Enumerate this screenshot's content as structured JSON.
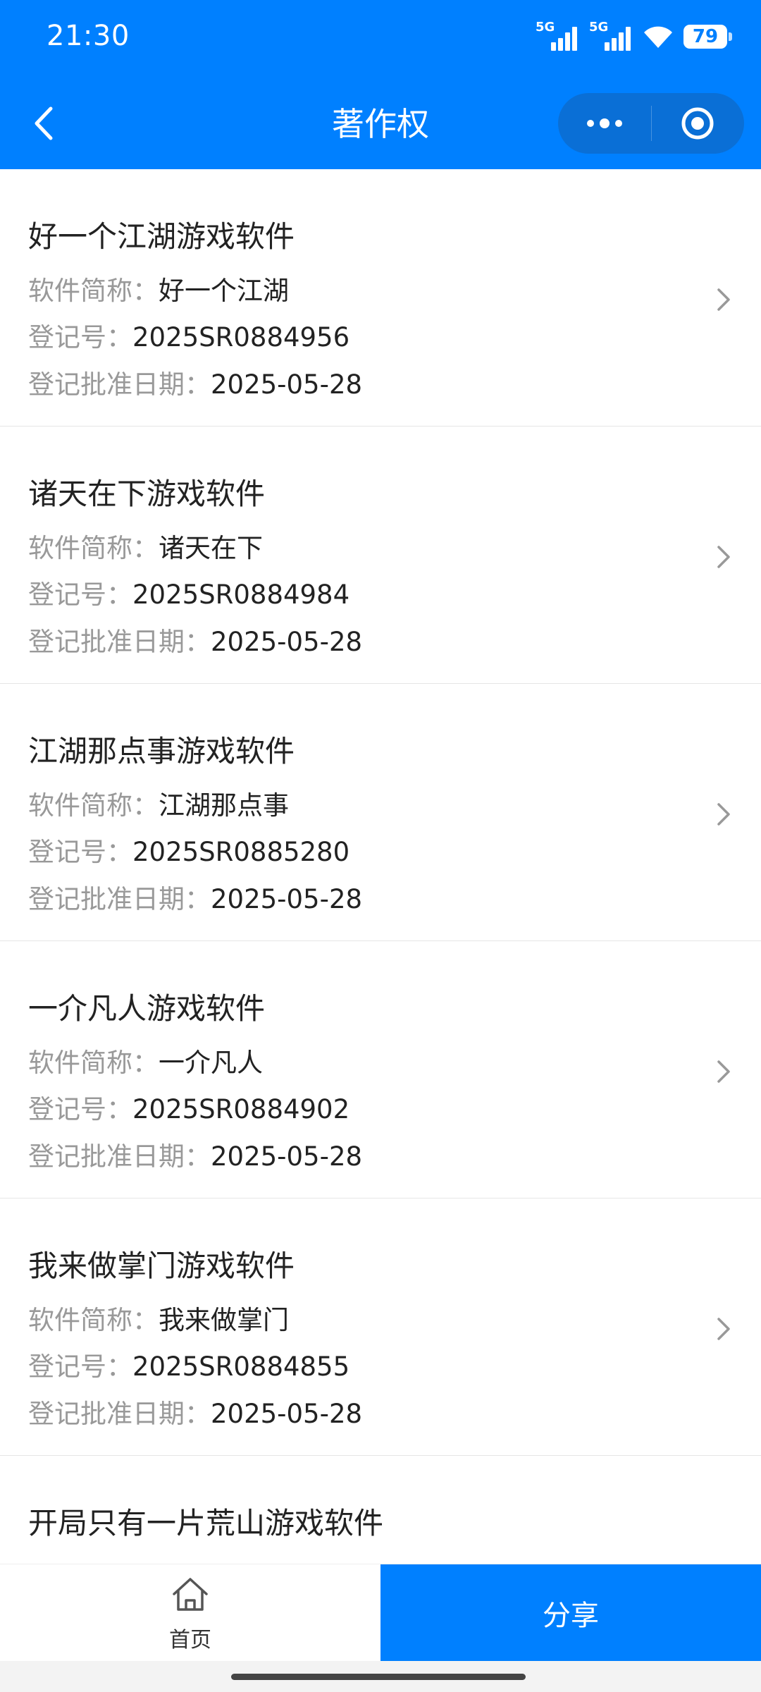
{
  "status_bar": {
    "time": "21:30",
    "signal1_label": "5G",
    "signal2_label": "5G",
    "battery": "79",
    "icons": [
      "signal-5g-icon",
      "signal-5g-icon",
      "wifi-icon",
      "battery-icon"
    ]
  },
  "nav": {
    "title": "著作权",
    "back_icon": "chevron-left-icon",
    "more_icon": "more-dots-icon",
    "close_icon": "target-circle-icon"
  },
  "items": [
    {
      "title": "好一个江湖游戏软件",
      "short_label": "软件简称：",
      "short_value": "好一个江湖",
      "reg_label": "登记号：",
      "reg_value": "2025SR0884956",
      "date_label": "登记批准日期：",
      "date_value": "2025-05-28"
    },
    {
      "title": "诸天在下游戏软件",
      "short_label": "软件简称：",
      "short_value": "诸天在下",
      "reg_label": "登记号：",
      "reg_value": "2025SR0884984",
      "date_label": "登记批准日期：",
      "date_value": "2025-05-28"
    },
    {
      "title": "江湖那点事游戏软件",
      "short_label": "软件简称：",
      "short_value": "江湖那点事",
      "reg_label": "登记号：",
      "reg_value": "2025SR0885280",
      "date_label": "登记批准日期：",
      "date_value": "2025-05-28"
    },
    {
      "title": "一介凡人游戏软件",
      "short_label": "软件简称：",
      "short_value": "一介凡人",
      "reg_label": "登记号：",
      "reg_value": "2025SR0884902",
      "date_label": "登记批准日期：",
      "date_value": "2025-05-28"
    },
    {
      "title": "我来做掌门游戏软件",
      "short_label": "软件简称：",
      "short_value": "我来做掌门",
      "reg_label": "登记号：",
      "reg_value": "2025SR0884855",
      "date_label": "登记批准日期：",
      "date_value": "2025-05-28"
    },
    {
      "title": "开局只有一片荒山游戏软件"
    }
  ],
  "bottom_bar": {
    "home_label": "首页",
    "home_icon": "home-icon",
    "share_label": "分享"
  },
  "colors": {
    "brand": "#0080ff",
    "capsule": "#0a6fd6",
    "label_gray": "#999999",
    "text": "#222222"
  }
}
